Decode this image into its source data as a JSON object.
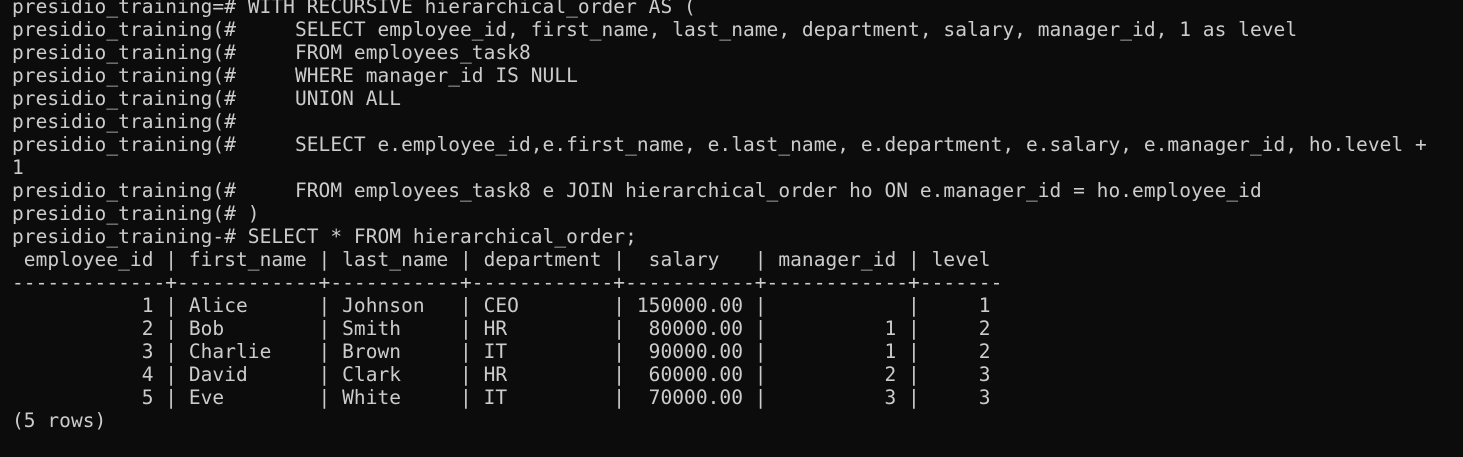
{
  "terminal": {
    "lines": [
      "presidio_training=# WITH RECURSIVE hierarchical_order AS (",
      "presidio_training(#     SELECT employee_id, first_name, last_name, department, salary, manager_id, 1 as level",
      "presidio_training(#     FROM employees_task8",
      "presidio_training(#     WHERE manager_id IS NULL",
      "presidio_training(#     UNION ALL",
      "presidio_training(#",
      "presidio_training(#     SELECT e.employee_id,e.first_name, e.last_name, e.department, e.salary, e.manager_id, ho.level +",
      "1",
      "presidio_training(#     FROM employees_task8 e JOIN hierarchical_order ho ON e.manager_id = ho.employee_id",
      "presidio_training(# )",
      "presidio_training-# SELECT * FROM hierarchical_order;",
      " employee_id | first_name | last_name | department |  salary   | manager_id | level",
      "-------------+------------+-----------+------------+-----------+------------+-------",
      "           1 | Alice      | Johnson   | CEO        | 150000.00 |            |     1",
      "           2 | Bob        | Smith     | HR         |  80000.00 |          1 |     2",
      "           3 | Charlie    | Brown     | IT         |  90000.00 |          1 |     2",
      "           4 | David      | Clark     | HR         |  60000.00 |          2 |     3",
      "           5 | Eve        | White     | IT         |  70000.00 |          3 |     3",
      "(5 rows)"
    ],
    "colors": {
      "background": "#0c0c0c",
      "text": "#cccccc"
    }
  }
}
